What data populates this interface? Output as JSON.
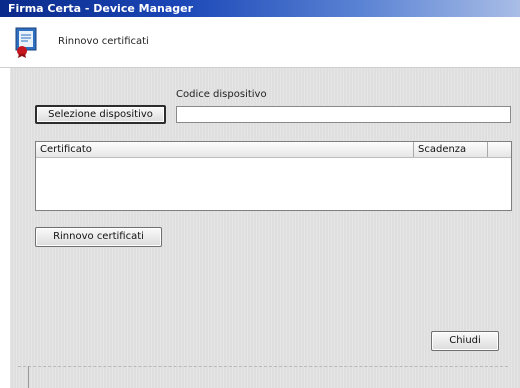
{
  "window": {
    "title": "Firma Certa - Device Manager"
  },
  "header": {
    "title": "Rinnovo certificati",
    "icon": "certificate-icon"
  },
  "form": {
    "select_device_button": "Selezione dispositivo",
    "device_code_label": "Codice dispositivo",
    "device_code_value": "",
    "certificates_table": {
      "columns": [
        "Certificato",
        "Scadenza"
      ],
      "rows": []
    },
    "renew_button": "Rinnovo certificati",
    "close_button": "Chiudi"
  }
}
